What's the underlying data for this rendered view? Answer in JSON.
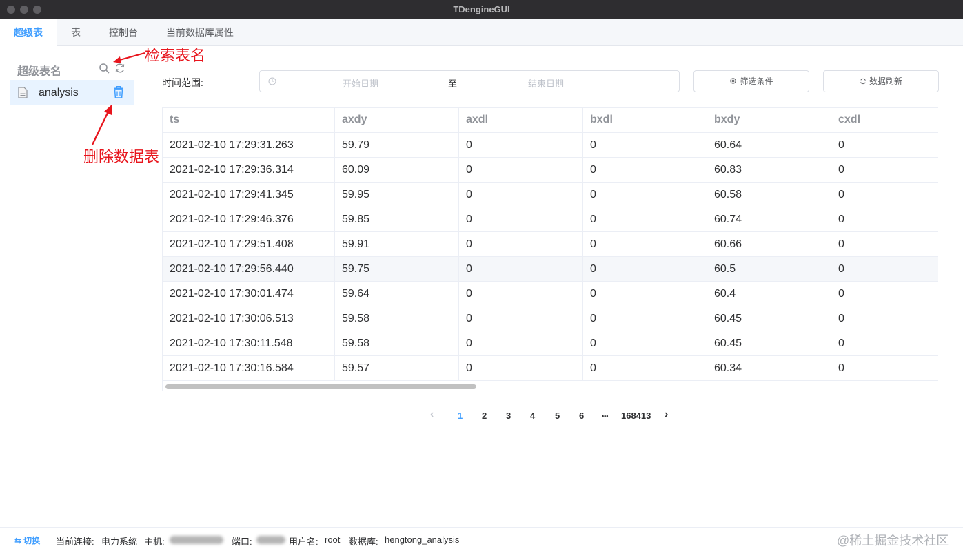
{
  "window": {
    "title": "TDengineGUI"
  },
  "tabs": [
    {
      "label": "超级表",
      "active": true
    },
    {
      "label": "表",
      "active": false
    },
    {
      "label": "控制台",
      "active": false
    },
    {
      "label": "当前数据库属性",
      "active": false
    }
  ],
  "sidebar": {
    "title": "超级表名",
    "search_icon": "search-icon",
    "refresh_icon": "refresh-icon",
    "items": [
      {
        "label": "analysis",
        "icon": "document-icon",
        "delete_icon": "trash-icon"
      }
    ]
  },
  "annotations": {
    "search_note": "检索表名",
    "delete_note": "删除数据表",
    "color": "#e8151d"
  },
  "filter": {
    "label": "时间范围:",
    "start_placeholder": "开始日期",
    "separator": "至",
    "end_placeholder": "结束日期",
    "filter_button": "筛选条件",
    "refresh_button": "数据刷新"
  },
  "table": {
    "columns": [
      "ts",
      "axdy",
      "axdl",
      "bxdl",
      "bxdy",
      "cxdl"
    ],
    "rows": [
      [
        "2021-02-10 17:29:31.263",
        "59.79",
        "0",
        "0",
        "60.64",
        "0"
      ],
      [
        "2021-02-10 17:29:36.314",
        "60.09",
        "0",
        "0",
        "60.83",
        "0"
      ],
      [
        "2021-02-10 17:29:41.345",
        "59.95",
        "0",
        "0",
        "60.58",
        "0"
      ],
      [
        "2021-02-10 17:29:46.376",
        "59.85",
        "0",
        "0",
        "60.74",
        "0"
      ],
      [
        "2021-02-10 17:29:51.408",
        "59.91",
        "0",
        "0",
        "60.66",
        "0"
      ],
      [
        "2021-02-10 17:29:56.440",
        "59.75",
        "0",
        "0",
        "60.5",
        "0"
      ],
      [
        "2021-02-10 17:30:01.474",
        "59.64",
        "0",
        "0",
        "60.4",
        "0"
      ],
      [
        "2021-02-10 17:30:06.513",
        "59.58",
        "0",
        "0",
        "60.45",
        "0"
      ],
      [
        "2021-02-10 17:30:11.548",
        "59.58",
        "0",
        "0",
        "60.45",
        "0"
      ],
      [
        "2021-02-10 17:30:16.584",
        "59.57",
        "0",
        "0",
        "60.34",
        "0"
      ]
    ]
  },
  "pagination": {
    "prev": "‹",
    "pages": [
      "1",
      "2",
      "3",
      "4",
      "5",
      "6"
    ],
    "current": "1",
    "ellipsis": "•••",
    "last": "168413",
    "next": "›"
  },
  "statusbar": {
    "switch": "切换",
    "connection_label": "当前连接:",
    "connection_value": "电力系统",
    "host_label": "主机:",
    "port_label": "端口:",
    "user_label": "用户名:",
    "user_value": "root",
    "db_label": "数据库:",
    "db_value": "hengtong_analysis"
  },
  "watermark": "@稀土掘金技术社区",
  "colors": {
    "accent": "#409eff",
    "highlight_row": "#f5f7fa"
  }
}
